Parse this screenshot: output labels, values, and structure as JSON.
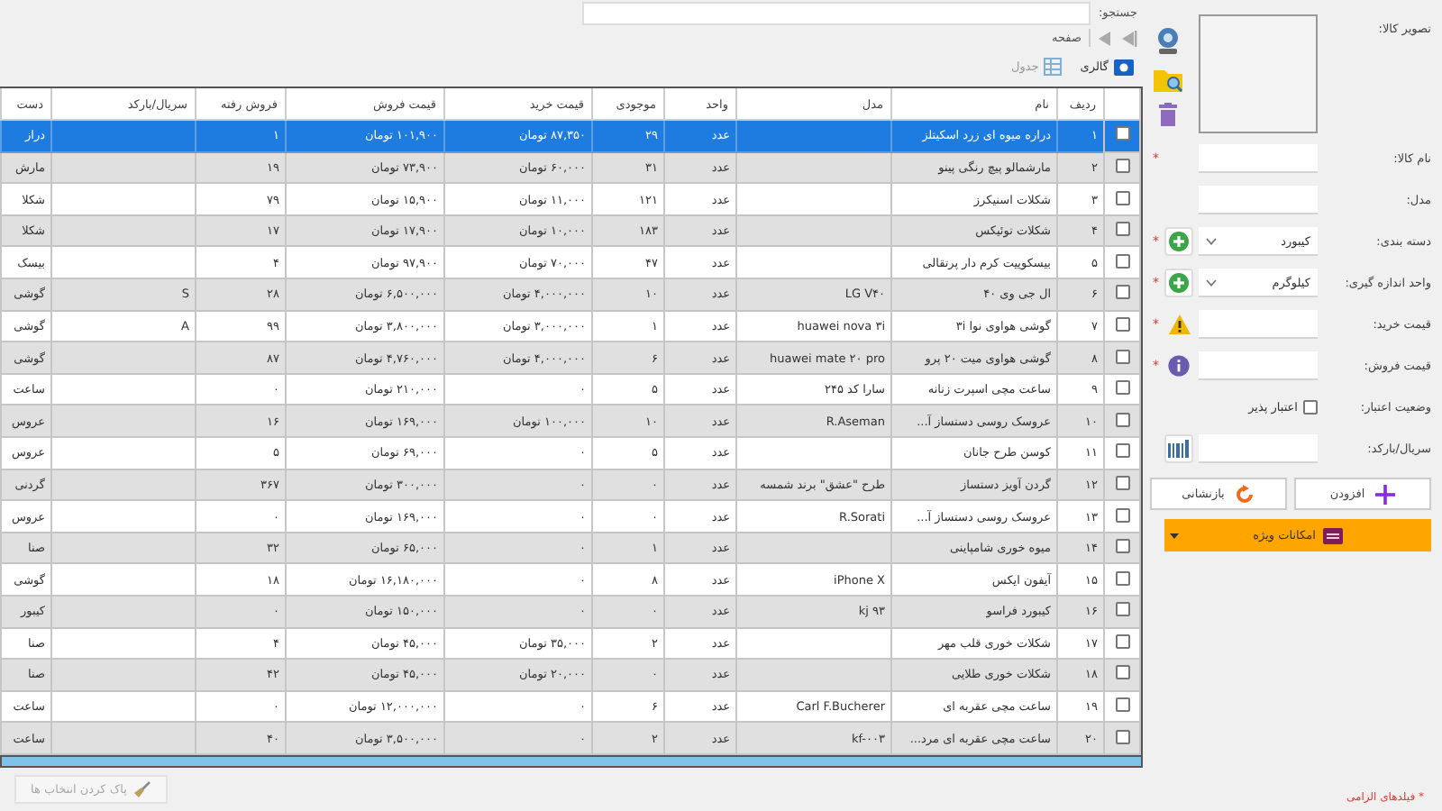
{
  "toolbar": {
    "search_label": "جستجو:",
    "page_label": "صفحه",
    "views": [
      {
        "kind": "gallery",
        "label": "گالری",
        "selected": true
      },
      {
        "kind": "table",
        "label": "جدول",
        "selected": false
      }
    ]
  },
  "table": {
    "columns": [
      "ردیف",
      "نام",
      "مدل",
      "واحد",
      "موجودی",
      "قیمت خرید",
      "قیمت فروش",
      "فروش رفته",
      "سریال/بارکد",
      "دست"
    ],
    "rows": [
      {
        "selected": true,
        "checked": false,
        "cells": [
          "۱",
          "درازه میوه ای زرد اسکیتلز",
          null,
          "عدد",
          "۲۹",
          "۸۷,۳۵۰ تومان",
          "۱۰۱,۹۰۰ تومان",
          "۱",
          null,
          "دراز"
        ]
      },
      {
        "selected": false,
        "checked": false,
        "cells": [
          "۲",
          "مارشمالو پیچ رنگی پینو",
          null,
          "عدد",
          "۳۱",
          "۶۰,۰۰۰ تومان",
          "۷۳,۹۰۰ تومان",
          "۱۹",
          null,
          "مارش"
        ]
      },
      {
        "selected": false,
        "checked": false,
        "cells": [
          "۳",
          "شکلات اسنیکرز",
          null,
          "عدد",
          "۱۲۱",
          "۱۱,۰۰۰ تومان",
          "۱۵,۹۰۰ تومان",
          "۷۹",
          null,
          "شکلا"
        ]
      },
      {
        "selected": false,
        "checked": false,
        "cells": [
          "۴",
          "شکلات توئیکس",
          null,
          "عدد",
          "۱۸۳",
          "۱۰,۰۰۰ تومان",
          "۱۷,۹۰۰ تومان",
          "۱۷",
          null,
          "شکلا"
        ]
      },
      {
        "selected": false,
        "checked": false,
        "cells": [
          "۵",
          "بیسکوییت کرم دار پرتقالی",
          null,
          "عدد",
          "۴۷",
          "۷۰,۰۰۰ تومان",
          "۹۷,۹۰۰ تومان",
          "۴",
          null,
          "بیسک"
        ]
      },
      {
        "selected": false,
        "checked": false,
        "cells": [
          "۶",
          "ال جی وی ۴۰",
          "LG V۴۰",
          "عدد",
          "۱۰",
          "۴,۰۰۰,۰۰۰ تومان",
          "۶,۵۰۰,۰۰۰ تومان",
          "۲۸",
          "S",
          "گوشی"
        ]
      },
      {
        "selected": false,
        "checked": false,
        "cells": [
          "۷",
          "گوشی هواوی نوا ۳i",
          "huawei nova ۳i",
          "عدد",
          "۱",
          "۳,۰۰۰,۰۰۰ تومان",
          "۳,۸۰۰,۰۰۰ تومان",
          "۹۹",
          "A",
          "گوشی"
        ]
      },
      {
        "selected": false,
        "checked": false,
        "cells": [
          "۸",
          "گوشی هواوی میت ۲۰ پرو",
          "huawei mate ۲۰ pro",
          "عدد",
          "۶",
          "۴,۰۰۰,۰۰۰ تومان",
          "۴,۷۶۰,۰۰۰ تومان",
          "۸۷",
          null,
          "گوشی"
        ]
      },
      {
        "selected": false,
        "checked": false,
        "cells": [
          "۹",
          "ساعت مچی اسپرت زنانه",
          "سارا کد ۲۴۵",
          "عدد",
          "۵",
          "۰",
          "۲۱۰,۰۰۰ تومان",
          "۰",
          null,
          "ساعت"
        ]
      },
      {
        "selected": false,
        "checked": false,
        "cells": [
          "۱۰",
          "عروسک روسی دستساز آ...",
          "R.Aseman",
          "عدد",
          "۱۰",
          "۱۰۰,۰۰۰ تومان",
          "۱۶۹,۰۰۰ تومان",
          "۱۶",
          null,
          "عروس"
        ]
      },
      {
        "selected": false,
        "checked": false,
        "cells": [
          "۱۱",
          "کوسن طرح جانان",
          null,
          "عدد",
          "۵",
          "۰",
          "۶۹,۰۰۰ تومان",
          "۵",
          null,
          "عروس"
        ]
      },
      {
        "selected": false,
        "checked": false,
        "cells": [
          "۱۲",
          "گردن آویز دستساز",
          "طرح \"عشق\" برند شمسه",
          "عدد",
          "۰",
          "۰",
          "۳۰۰,۰۰۰ تومان",
          "۳۶۷",
          null,
          "گردنی"
        ]
      },
      {
        "selected": false,
        "checked": false,
        "cells": [
          "۱۳",
          "عروسک روسی دستساز آ...",
          "R.Sorati",
          "عدد",
          "۰",
          "۰",
          "۱۶۹,۰۰۰ تومان",
          "۰",
          null,
          "عروس"
        ]
      },
      {
        "selected": false,
        "checked": false,
        "cells": [
          "۱۴",
          "میوه خوری شامپاینی",
          null,
          "عدد",
          "۱",
          "۰",
          "۶۵,۰۰۰ تومان",
          "۳۲",
          null,
          "صنا"
        ]
      },
      {
        "selected": false,
        "checked": false,
        "cells": [
          "۱۵",
          "آیفون ایکس",
          "iPhone X",
          "عدد",
          "۸",
          "۰",
          "۱۶,۱۸۰,۰۰۰ تومان",
          "۱۸",
          null,
          "گوشی"
        ]
      },
      {
        "selected": false,
        "checked": false,
        "cells": [
          "۱۶",
          "کیبورد فراسو",
          "kj ۹۳",
          "عدد",
          "۰",
          "۰",
          "۱۵۰,۰۰۰ تومان",
          "۰",
          null,
          "کیبور"
        ]
      },
      {
        "selected": false,
        "checked": false,
        "cells": [
          "۱۷",
          "شکلات خوری قلب مهر",
          null,
          "عدد",
          "۲",
          "۳۵,۰۰۰ تومان",
          "۴۵,۰۰۰ تومان",
          "۴",
          null,
          "صنا"
        ]
      },
      {
        "selected": false,
        "checked": false,
        "cells": [
          "۱۸",
          "شکلات خوری طلایی",
          null,
          "عدد",
          "۰",
          "۲۰,۰۰۰ تومان",
          "۴۵,۰۰۰ تومان",
          "۴۲",
          null,
          "صنا"
        ]
      },
      {
        "selected": false,
        "checked": false,
        "cells": [
          "۱۹",
          "ساعت مچی عقربه ای",
          "Carl F.Bucherer",
          "عدد",
          "۶",
          "۰",
          "۱۲,۰۰۰,۰۰۰ تومان",
          "۰",
          null,
          "ساعت"
        ]
      },
      {
        "selected": false,
        "checked": false,
        "cells": [
          "۲۰",
          "ساعت مچی عقربه ای مرد...",
          "kf-۰۰۳",
          "عدد",
          "۲",
          "۰",
          "۳,۵۰۰,۰۰۰ تومان",
          "۴۰",
          null,
          "ساعت"
        ]
      }
    ]
  },
  "bottom_bar": {
    "clear_selection": {
      "label": "پاک کردن انتخاب ها",
      "disabled": true
    }
  },
  "form": {
    "fields": [
      {
        "kind": "image",
        "label": "تصویر کالا:"
      },
      {
        "kind": "text",
        "label": "نام کالا:",
        "required_mark": "*"
      },
      {
        "kind": "text",
        "label": "مدل:"
      },
      {
        "kind": "select",
        "label": "دسته بندی:",
        "value": "کیبورد",
        "required_mark": "*",
        "accessory": {
          "kind": "add"
        }
      },
      {
        "kind": "select",
        "label": "واحد اندازه گیری:",
        "value": "کیلوگرم",
        "required_mark": "*",
        "accessory": {
          "kind": "add"
        }
      },
      {
        "kind": "text",
        "label": "قیمت خرید:",
        "required_mark": "*",
        "accessory": {
          "kind": "warning"
        }
      },
      {
        "kind": "text",
        "label": "قیمت فروش:",
        "required_mark": "*",
        "accessory": {
          "kind": "info"
        }
      },
      {
        "kind": "checkbox",
        "label": "وضعیت اعتبار:",
        "option": "اعتبار پذیر",
        "checked": false
      },
      {
        "kind": "text",
        "label": "سریال/بارکد:",
        "accessory": {
          "kind": "barcode"
        }
      }
    ],
    "buttons": [
      {
        "kind": "add",
        "label": "افزودن"
      },
      {
        "kind": "reset",
        "label": "بازنشانی"
      }
    ],
    "special_button": "امکانات ویژه",
    "required_note": "* فیلدهای الزامی"
  }
}
